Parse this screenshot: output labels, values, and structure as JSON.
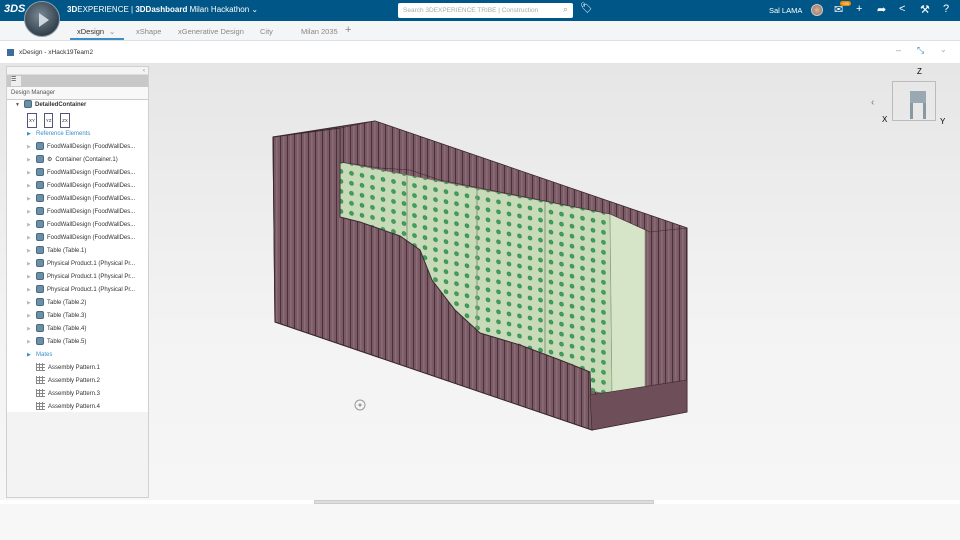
{
  "topbar": {
    "brand": "3DS",
    "app_bold": "3D",
    "app_rest": "EXPERIENCE | ",
    "dashboard": "3DDashboard",
    "space": "Milan Hackathon",
    "search_placeholder": "Search 3DEXPERIENCE TRIBE | Construction",
    "user": "Sal LAMA",
    "notif_badge": "+99"
  },
  "tabs": [
    {
      "label": "xDesign"
    },
    {
      "label": "xShape"
    },
    {
      "label": "xGenerative Design"
    },
    {
      "label": "City"
    },
    {
      "label": "Milan 2035"
    }
  ],
  "widget": {
    "title": "xDesign - xHack19Team2"
  },
  "panel": {
    "title": "Design Manager",
    "root": "DetailedContainer",
    "planes": [
      "XY",
      "YZ",
      "ZX"
    ],
    "items": [
      {
        "label": "Reference Elements",
        "type": "folder"
      },
      {
        "label": "FoodWallDesign (FoodWallDes...",
        "type": "part"
      },
      {
        "label": "Container (Container.1)",
        "type": "part"
      },
      {
        "label": "FoodWallDesign (FoodWallDes...",
        "type": "part"
      },
      {
        "label": "FoodWallDesign (FoodWallDes...",
        "type": "part"
      },
      {
        "label": "FoodWallDesign (FoodWallDes...",
        "type": "part"
      },
      {
        "label": "FoodWallDesign (FoodWallDes...",
        "type": "part"
      },
      {
        "label": "FoodWallDesign (FoodWallDes...",
        "type": "part"
      },
      {
        "label": "FoodWallDesign (FoodWallDes...",
        "type": "part"
      },
      {
        "label": "Table (Table.1)",
        "type": "part"
      },
      {
        "label": "Physical Product.1 (Physical Pr...",
        "type": "part"
      },
      {
        "label": "Physical Product.1 (Physical Pr...",
        "type": "part"
      },
      {
        "label": "Physical Product.1 (Physical Pr...",
        "type": "part"
      },
      {
        "label": "Table (Table.2)",
        "type": "part"
      },
      {
        "label": "Table (Table.3)",
        "type": "part"
      },
      {
        "label": "Table (Table.4)",
        "type": "part"
      },
      {
        "label": "Table (Table.5)",
        "type": "part"
      },
      {
        "label": "Mates",
        "type": "folder"
      },
      {
        "label": "Assembly Pattern.1",
        "type": "pattern"
      },
      {
        "label": "Assembly Pattern.2",
        "type": "pattern"
      },
      {
        "label": "Assembly Pattern.3",
        "type": "pattern"
      },
      {
        "label": "Assembly Pattern.4",
        "type": "pattern"
      }
    ]
  },
  "axes": {
    "x": "X",
    "y": "Y",
    "z": "Z"
  },
  "colors": {
    "topbar": "#005686",
    "accent": "#3b8ec6",
    "container": "#7a5a64",
    "panel_green": "#c8dbb8",
    "dot": "#3aa45a"
  }
}
